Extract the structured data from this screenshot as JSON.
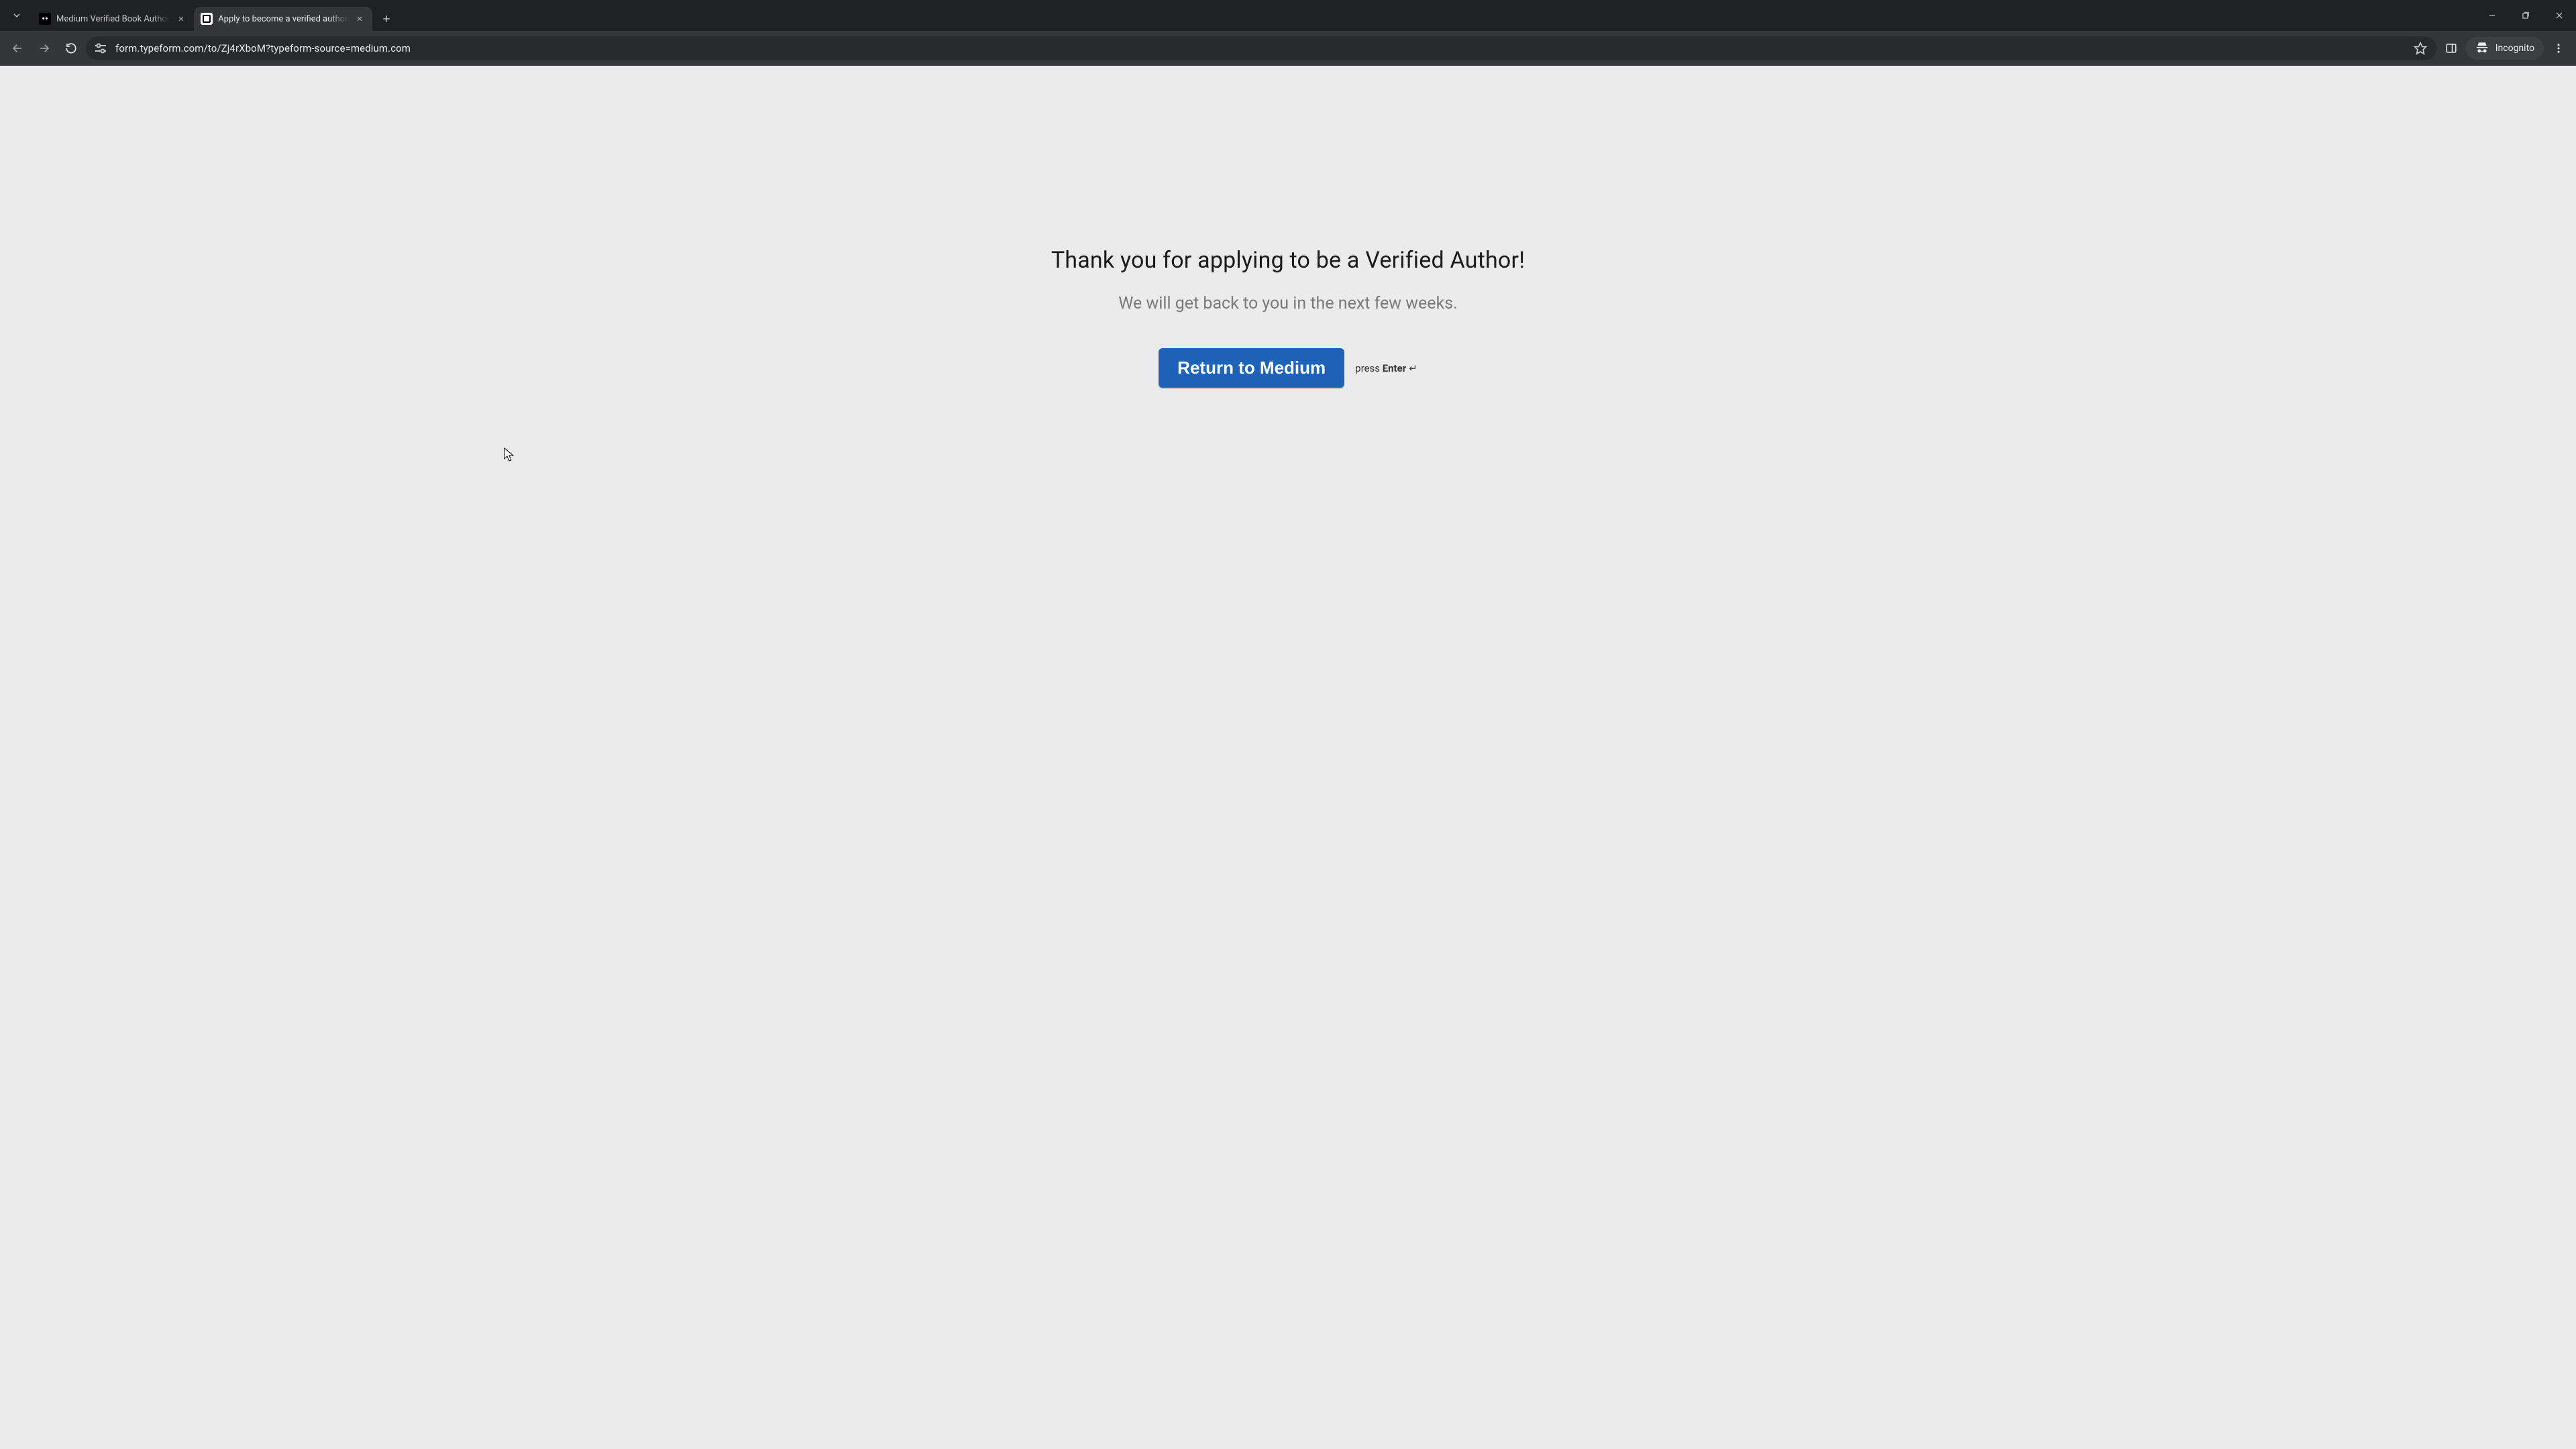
{
  "browser": {
    "tabs": [
      {
        "title": "Medium Verified Book Author",
        "active": false,
        "favicon": "medium"
      },
      {
        "title": "Apply to become a verified author",
        "active": true,
        "favicon": "typeform"
      }
    ],
    "url": "form.typeform.com/to/Zj4rXboM?typeform-source=medium.com",
    "incognito_label": "Incognito"
  },
  "page": {
    "heading": "Thank you for applying to be a Verified Author!",
    "subheading": "We will get back to you in the next few weeks.",
    "cta_label": "Return to Medium",
    "hint_prefix": "press ",
    "hint_key": "Enter",
    "hint_glyph": "↵"
  }
}
